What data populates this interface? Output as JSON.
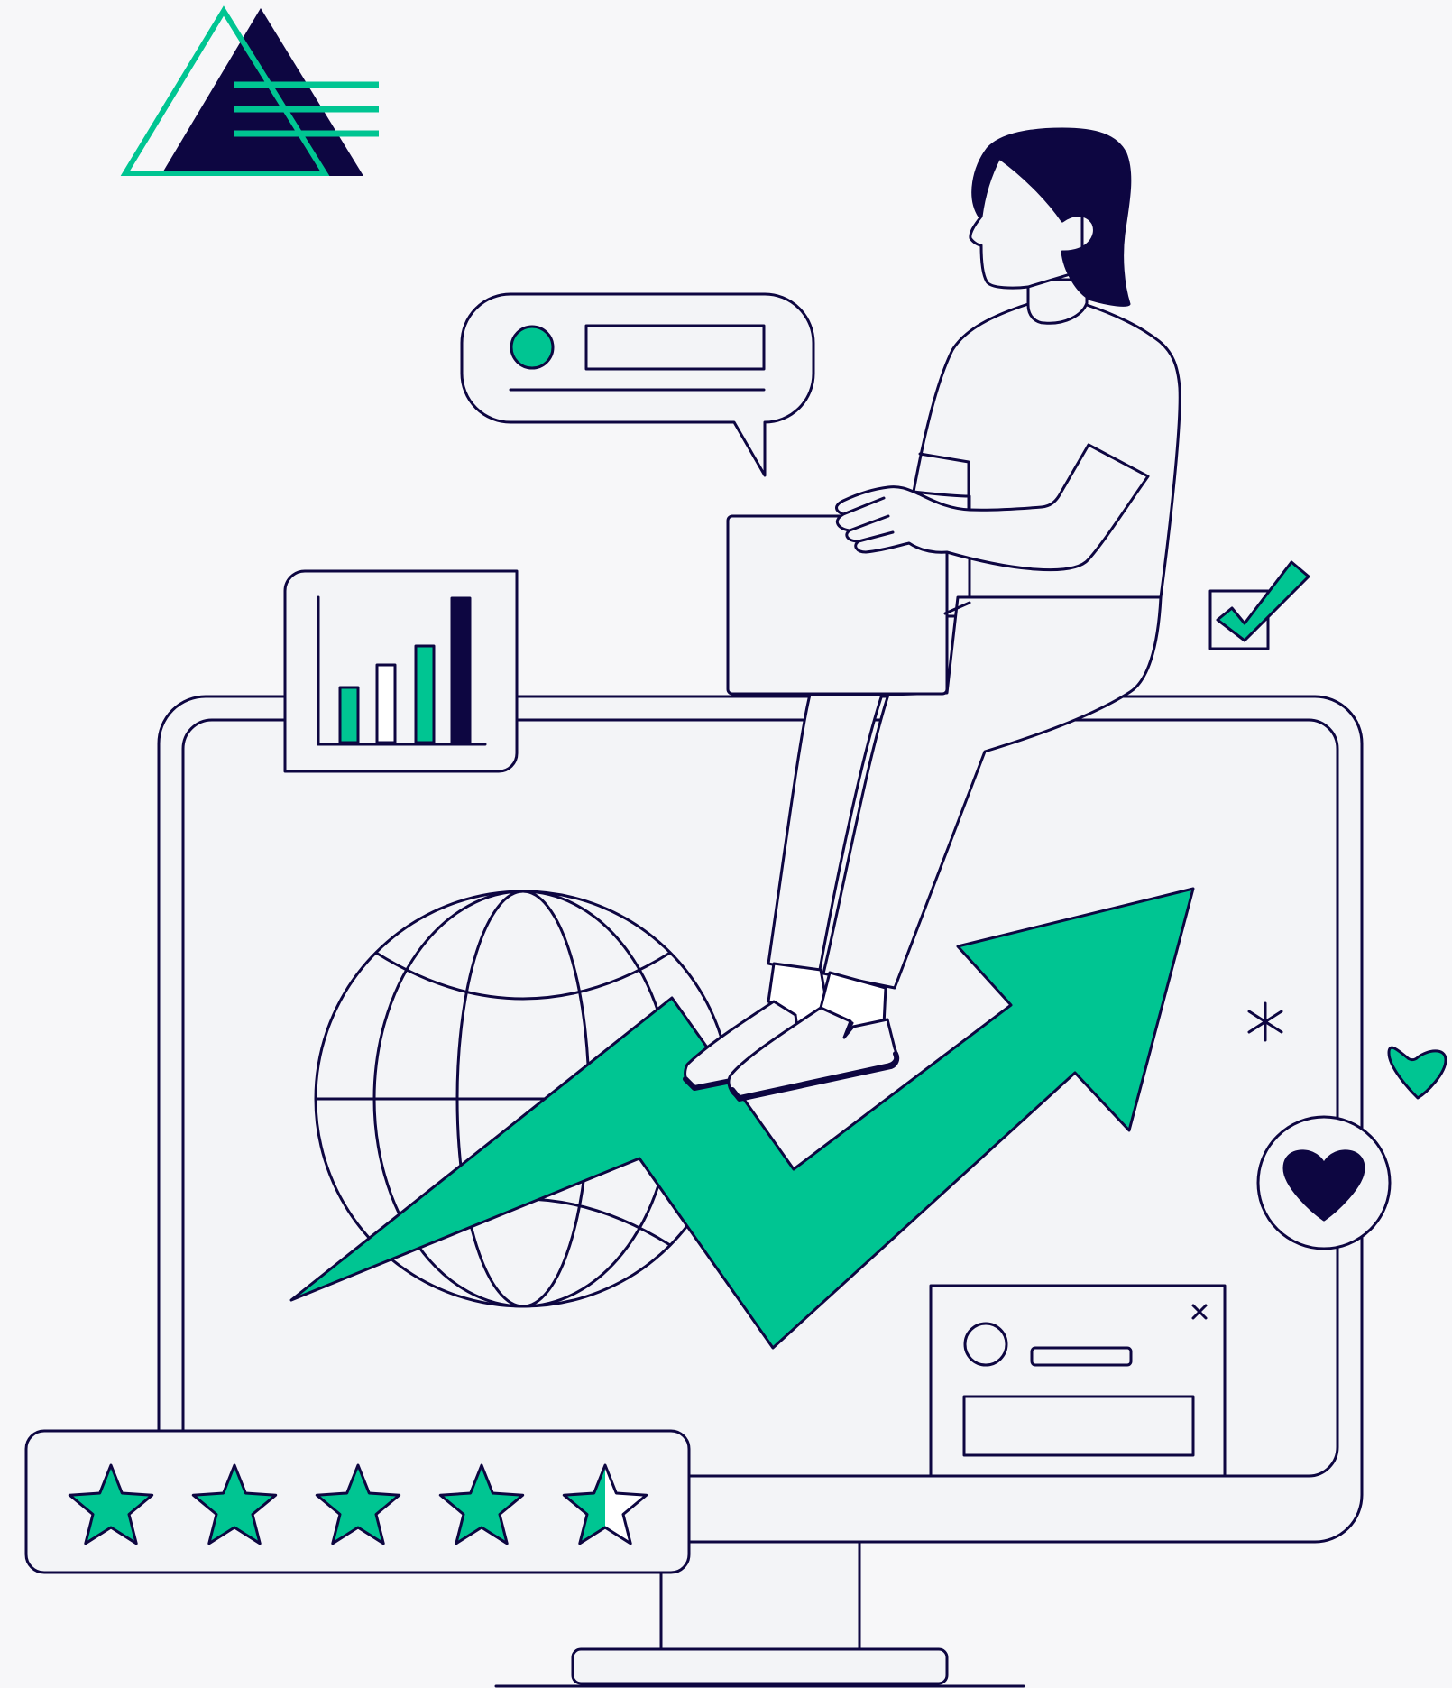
{
  "illustration": {
    "subject": "person-sitting-on-monitor-with-growth-arrow",
    "logo": {
      "shape": "triangle-with-lines"
    },
    "rating": {
      "stars_total": 5,
      "stars_filled": 4.5
    },
    "bar_widget": {
      "bar_levels": [
        0.38,
        0.54,
        0.67,
        1.0
      ],
      "bar_fills": [
        "green",
        "white",
        "green",
        "navy"
      ]
    },
    "icons": [
      "globe-icon",
      "growth-arrow-icon",
      "heart-icon",
      "checkmark-icon",
      "sparkle-icon",
      "close-icon",
      "star-icon"
    ],
    "colors": {
      "background": "#f7f7f9",
      "panel": "#f3f4f7",
      "outline": "#0d0641",
      "accent": "#00c592",
      "navy": "#0d0641",
      "white": "#ffffff"
    }
  }
}
